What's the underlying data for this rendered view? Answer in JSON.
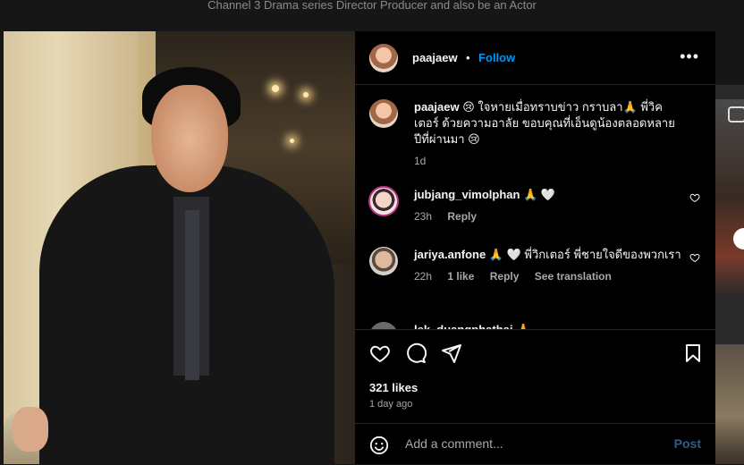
{
  "background": {
    "caption": "Channel 3 Drama series Director Producer and also be an Actor"
  },
  "post": {
    "author": "paajaew",
    "follow_label": "Follow",
    "separator": "•",
    "more_label": "•••"
  },
  "caption": {
    "username": "paajaew",
    "text": "😢 ใจหายเมื่อทราบข่าว กราบลา🙏 พี่วิคเตอร์ ด้วยความอาลัย ขอบคุณที่เอ็นดูน้องตลอดหลายปีที่ผ่านมา 😢",
    "time": "1d"
  },
  "comments": [
    {
      "username": "jubjang_vimolphan",
      "text": "🙏 🤍",
      "time": "23h",
      "reply_label": "Reply"
    },
    {
      "username": "jariya.anfone",
      "text": "🙏 🤍 พี่วิกเตอร์ พี่ชายใจดีของพวกเรา",
      "time": "22h",
      "likes": "1 like",
      "reply_label": "Reply",
      "translate_label": "See translation"
    },
    {
      "username": "lek_duangphathai",
      "text": "🙏"
    }
  ],
  "stats": {
    "likes": "321 likes",
    "posted": "1 day ago"
  },
  "add_comment": {
    "placeholder": "Add a comment...",
    "post_label": "Post"
  },
  "colors": {
    "accent": "#0095f6",
    "panel_bg": "#000000",
    "post_disabled": "#2f5f86"
  }
}
